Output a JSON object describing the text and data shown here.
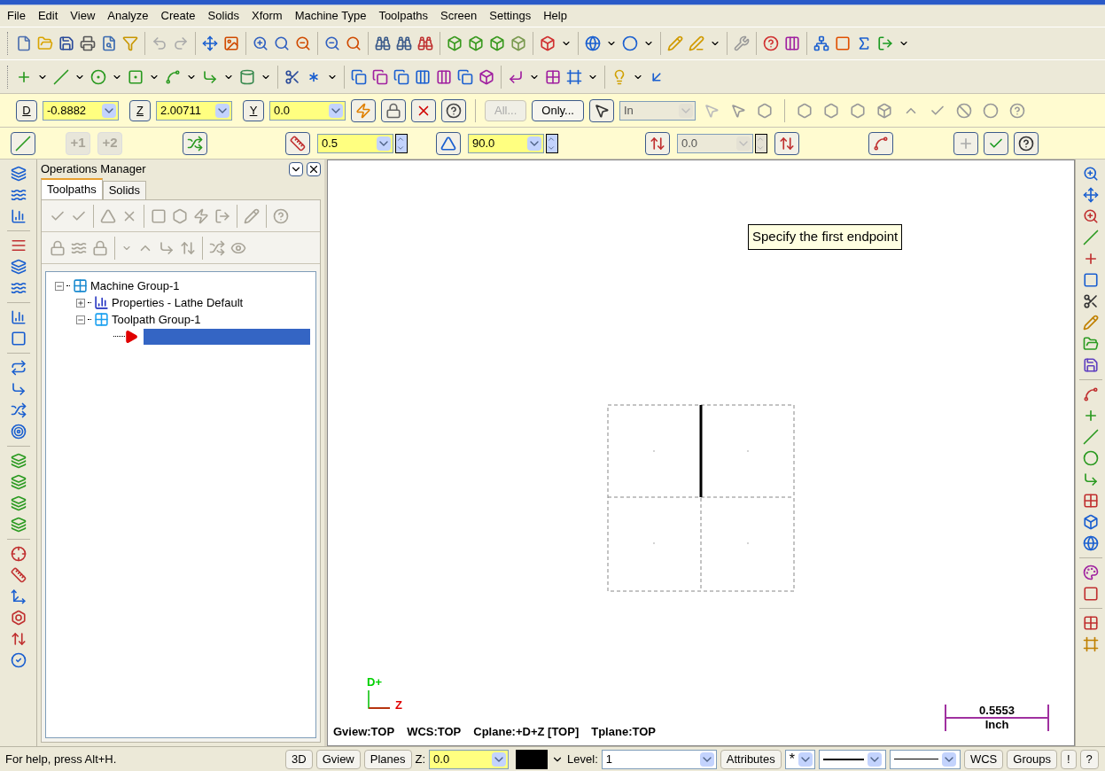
{
  "menu": [
    "File",
    "Edit",
    "View",
    "Analyze",
    "Create",
    "Solids",
    "Xform",
    "Machine Type",
    "Toolpaths",
    "Screen",
    "Settings",
    "Help"
  ],
  "autocursor": {
    "coordinates": [
      {
        "axis": "D",
        "value": "-0.8882"
      },
      {
        "axis": "Z",
        "value": "2.00711"
      },
      {
        "axis": "Y",
        "value": "0.0"
      }
    ],
    "buttons": [
      {
        "label": "All...",
        "disabled": true
      },
      {
        "label": "Only...",
        "disabled": false
      }
    ],
    "mask": {
      "value": "In",
      "disabled": true
    }
  },
  "ribbon": {
    "buttons": [
      {
        "label": "+1",
        "disabled": true
      },
      {
        "label": "+2",
        "disabled": true
      }
    ],
    "length": {
      "value": "0.5",
      "disabled": false
    },
    "angle": {
      "value": "90.0",
      "disabled": false
    },
    "offset": {
      "value": "0.0",
      "disabled": true
    }
  },
  "operations_manager": {
    "title": "Operations Manager",
    "tabs": [
      {
        "label": "Toolpaths",
        "selected": true
      },
      {
        "label": "Solids",
        "selected": false
      }
    ],
    "tree": [
      {
        "label": "Machine Group-1",
        "kind": "machine",
        "expanded": true,
        "children": [
          {
            "label": "Properties - Lathe Default",
            "kind": "properties",
            "expanded": false
          },
          {
            "label": "Toolpath Group-1",
            "kind": "group",
            "expanded": true,
            "children": [
              {
                "kind": "insert-arrow",
                "selected": true
              }
            ]
          }
        ]
      }
    ]
  },
  "graphics": {
    "prompt": "Specify the first endpoint",
    "axes": {
      "vertical": "D+",
      "horizontal": "Z"
    },
    "view_info": [
      "Gview:TOP",
      "WCS:TOP",
      "Cplane:+D+Z [TOP]",
      "Tplane:TOP"
    ],
    "scale": {
      "value": "0.5553",
      "unit": "Inch"
    }
  },
  "status_bar": {
    "help": "For help, press Alt+H.",
    "view_buttons": [
      "3D",
      "Gview",
      "Planes"
    ],
    "z": {
      "label": "Z:",
      "value": "0.0"
    },
    "color": "#000000",
    "level": {
      "label": "Level:",
      "value": "1"
    },
    "attributes": "Attributes",
    "point_style": "*",
    "right_buttons": [
      "WCS",
      "Groups",
      "!",
      "?"
    ]
  }
}
